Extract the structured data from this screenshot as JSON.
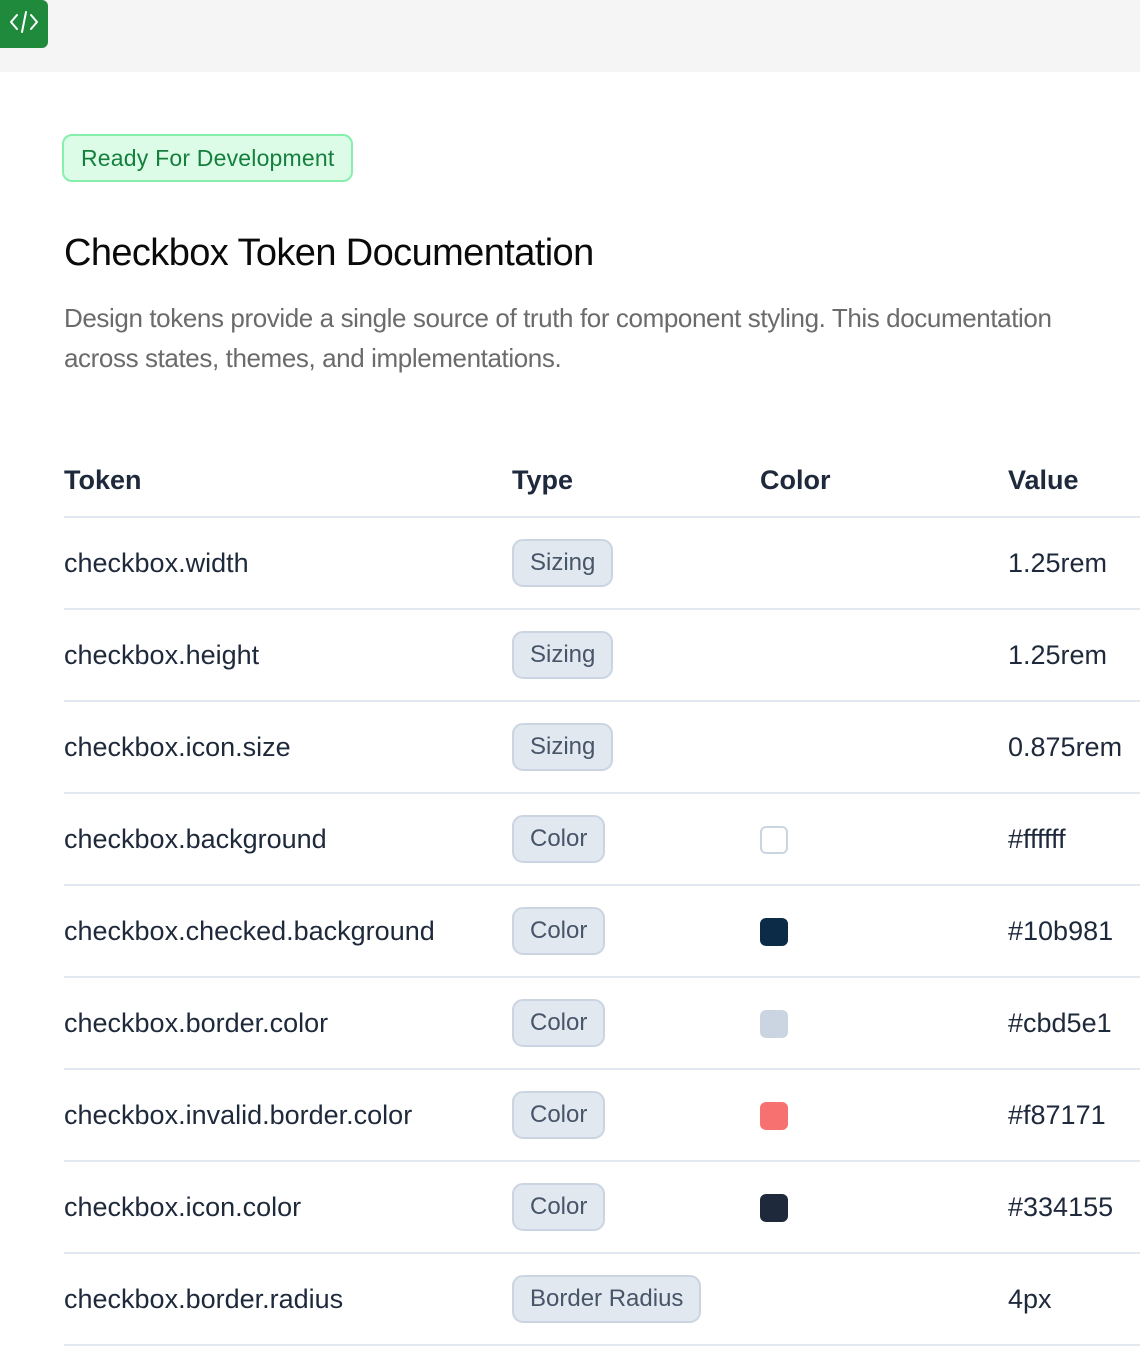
{
  "header": {
    "logo_icon": "code-icon",
    "logo_color": "#1f8a3b"
  },
  "status": {
    "label": "Ready For Development",
    "color": "#15803d"
  },
  "page": {
    "title": "Checkbox Token Documentation",
    "description_line1": "Design tokens provide a single source of truth for component styling. This documentation",
    "description_line2": "across states, themes, and implementations."
  },
  "table": {
    "columns": [
      "Token",
      "Type",
      "Color",
      "Value"
    ],
    "rows": [
      {
        "token": "checkbox.width",
        "type": "Sizing",
        "swatch": null,
        "value": "1.25rem"
      },
      {
        "token": "checkbox.height",
        "type": "Sizing",
        "swatch": null,
        "value": "1.25rem"
      },
      {
        "token": "checkbox.icon.size",
        "type": "Sizing",
        "swatch": null,
        "value": "0.875rem"
      },
      {
        "token": "checkbox.background",
        "type": "Color",
        "swatch": "#ffffff",
        "value": "#ffffff"
      },
      {
        "token": "checkbox.checked.background",
        "type": "Color",
        "swatch": "#0c2b47",
        "value": "#10b981"
      },
      {
        "token": "checkbox.border.color",
        "type": "Color",
        "swatch": "#cbd5e1",
        "value": "#cbd5e1"
      },
      {
        "token": "checkbox.invalid.border.color",
        "type": "Color",
        "swatch": "#f87171",
        "value": "#f87171"
      },
      {
        "token": "checkbox.icon.color",
        "type": "Color",
        "swatch": "#1e293b",
        "value": "#334155"
      },
      {
        "token": "checkbox.border.radius",
        "type": "Border Radius",
        "swatch": null,
        "value": "4px"
      }
    ]
  }
}
